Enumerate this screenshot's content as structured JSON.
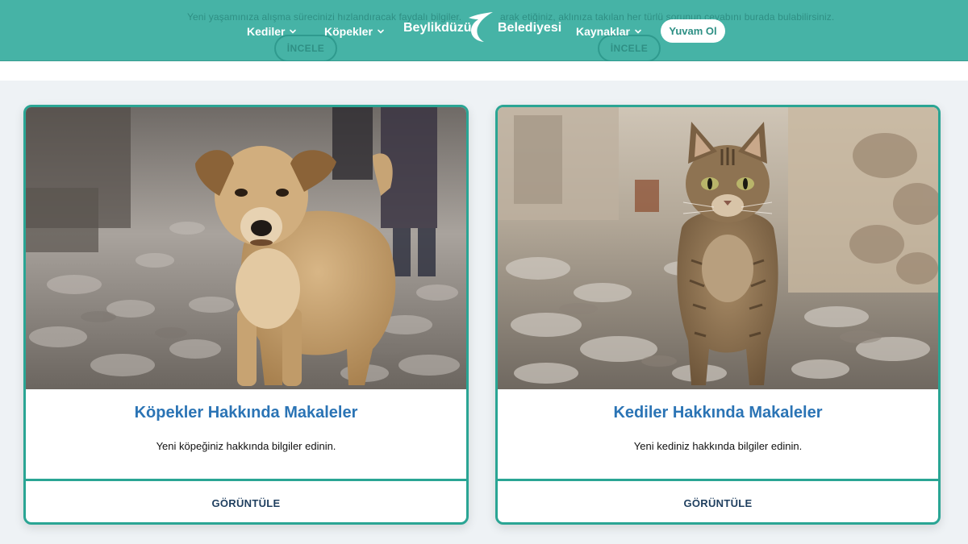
{
  "header": {
    "ghost_text_left": "Yeni yaşamınıza alışma sürecinizi hızlandıracak faydalı bilgiler.",
    "ghost_text_right": "arak etiğiniz, aklınıza takılan her türlü sorunun cevabını burada bulabilirsiniz.",
    "ghost_button_left": "İNCELE",
    "ghost_button_right": "İNCELE",
    "nav": {
      "kediler": "Kediler",
      "kopekler": "Köpekler",
      "kaynaklar": "Kaynaklar"
    },
    "logo_word1": "Beylikdüzü",
    "logo_word2": "Belediyesi",
    "cta_label": "Yuvam Ol"
  },
  "cards": [
    {
      "title": "Köpekler Hakkında Makaleler",
      "description": "Yeni köpeğiniz hakkında bilgiler edinin.",
      "action": "GÖRÜNTÜLE",
      "image": "stray-dog-photo"
    },
    {
      "title": "Kediler Hakkında Makaleler",
      "description": "Yeni kediniz hakkında bilgiler edinin.",
      "action": "GÖRÜNTÜLE",
      "image": "tabby-cat-photo"
    }
  ],
  "colors": {
    "header_bg": "#46b3a6",
    "card_border": "#2aa594",
    "card_title": "#2b74b5",
    "page_bg": "#eef2f5"
  }
}
